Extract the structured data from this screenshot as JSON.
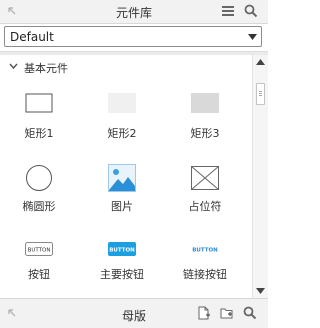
{
  "header": {
    "title": "元件库",
    "icons": [
      "collapse-corner-icon",
      "menu-icon",
      "search-icon"
    ]
  },
  "library_select": {
    "value": "Default"
  },
  "section": {
    "label": "基本元件",
    "expanded": true
  },
  "widgets": [
    {
      "label": "矩形1",
      "icon": "rectangle-outline-icon"
    },
    {
      "label": "矩形2",
      "icon": "rectangle-light-fill-icon"
    },
    {
      "label": "矩形3",
      "icon": "rectangle-dark-fill-icon"
    },
    {
      "label": "椭圆形",
      "icon": "ellipse-icon"
    },
    {
      "label": "图片",
      "icon": "image-icon"
    },
    {
      "label": "占位符",
      "icon": "placeholder-icon"
    },
    {
      "label": "按钮",
      "icon": "button-icon",
      "thumb_text": "BUTTON"
    },
    {
      "label": "主要按钮",
      "icon": "primary-button-icon",
      "thumb_text": "BUTTON"
    },
    {
      "label": "链接按钮",
      "icon": "link-button-icon",
      "thumb_text": "BUTTON"
    }
  ],
  "footer": {
    "title": "母版",
    "icons": [
      "expand-corner-icon",
      "add-master-icon",
      "add-folder-icon",
      "search-icon"
    ]
  },
  "colors": {
    "primary_button": "#1a9fe0",
    "link_button_text": "#2a8bd0",
    "panel_bg": "#f2f2f2"
  }
}
